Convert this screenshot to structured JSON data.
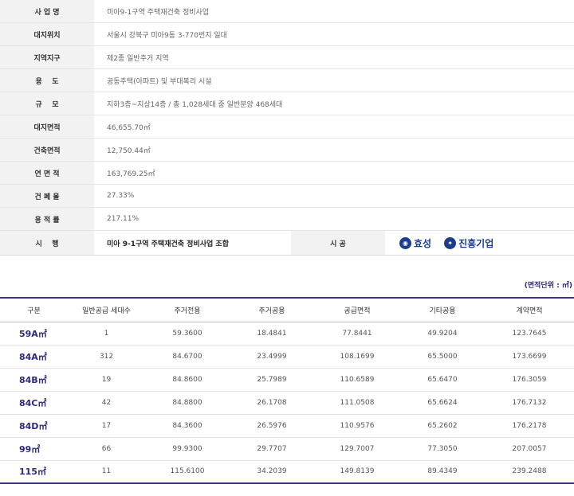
{
  "project_info": {
    "rows": [
      {
        "label": "사 업 명",
        "value": "미아9-1구역 주택재건축 정비사업"
      },
      {
        "label": "대지위치",
        "value": "서울시 강북구 미아9동 3-770번지 일대"
      },
      {
        "label": "지역지구",
        "value": "제2종 일반주거 지역"
      },
      {
        "label": "용    도",
        "value": "공동주택(아파트) 및 부대복리 시설"
      },
      {
        "label": "규    모",
        "value": "지하3층~지상14층 / 총 1,028세대 중 일반분양 468세대"
      },
      {
        "label": "대지면적",
        "value": "46,655.70㎡"
      },
      {
        "label": "건축면적",
        "value": "12,750.44㎡"
      },
      {
        "label": "연 면 적",
        "value": "163,769.25㎡"
      },
      {
        "label": "건 폐 율",
        "value": "27.33%"
      },
      {
        "label": "용 적 률",
        "value": "217.11%"
      }
    ],
    "executor_label": "시    행",
    "executor_value": "미아 9-1구역 주택재건축 정비사업 조합",
    "builder_label": "시 공",
    "builders": [
      {
        "icon": "hyosung-logo-icon",
        "name": "효성"
      },
      {
        "icon": "jinheung-logo-icon",
        "name": "진흥기업"
      }
    ]
  },
  "unit_note": "(면적단위 : ㎡)",
  "area_table": {
    "headers": [
      "구분",
      "일반공급 세대수",
      "주거전용",
      "주거공용",
      "공급면적",
      "기타공용",
      "계약면적"
    ],
    "rows": [
      [
        "59A㎡",
        "1",
        "59.3600",
        "18.4841",
        "77.8441",
        "49.9204",
        "123.7645"
      ],
      [
        "84A㎡",
        "312",
        "84.6700",
        "23.4999",
        "108.1699",
        "65.5000",
        "173.6699"
      ],
      [
        "84B㎡",
        "19",
        "84.8600",
        "25.7989",
        "110.6589",
        "65.6470",
        "176.3059"
      ],
      [
        "84C㎡",
        "42",
        "84.8800",
        "26.1708",
        "111.0508",
        "65.6624",
        "176.7132"
      ],
      [
        "84D㎡",
        "17",
        "84.3600",
        "26.5976",
        "110.9576",
        "65.2602",
        "176.2178"
      ],
      [
        "99㎡",
        "66",
        "99.9300",
        "29.7707",
        "129.7007",
        "77.3050",
        "207.0057"
      ],
      [
        "115㎡",
        "11",
        "115.6100",
        "34.2039",
        "149.8139",
        "89.4349",
        "239.2488"
      ]
    ]
  },
  "colors": {
    "accent": "#3a3585",
    "logo": "#1a3e8c",
    "label_bg": "#f2f2f2"
  }
}
